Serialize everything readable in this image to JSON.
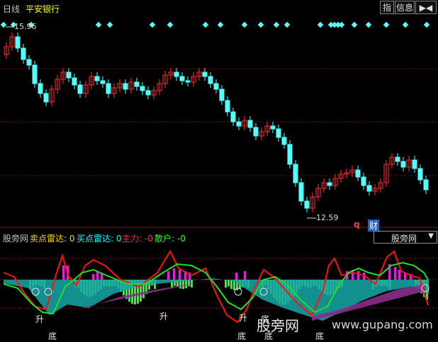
{
  "title_bar": {
    "period": "日线",
    "stock_name": "平安银行",
    "btn_zhi": "指",
    "btn_info": "信息",
    "btn_nav": "▶◀"
  },
  "price_panel": {
    "high_label": "15.96",
    "low_label": "12.59",
    "q_mark": "q",
    "cai_mark": "财",
    "colors": {
      "up": "#ff3030",
      "down": "#54ffff",
      "diamond": "#54ffff",
      "grid": "#8b0000"
    }
  },
  "indicator_header": {
    "name": "股旁网",
    "sell_radar": "卖点雷达: 0",
    "buy_radar": "买点雷达: 0",
    "main_force": "主力: -0",
    "retail": "散户: -0"
  },
  "indicator_select": {
    "value": "股旁网"
  },
  "signals": {
    "sheng_1": "升",
    "sheng_2": "升",
    "sheng_3": "升",
    "di_1": "底",
    "di_2": "底",
    "di_3": "底",
    "di_4": "底",
    "di_5": "底"
  },
  "watermark": {
    "text": "股旁网",
    "url": "www.gupang.com"
  }
}
